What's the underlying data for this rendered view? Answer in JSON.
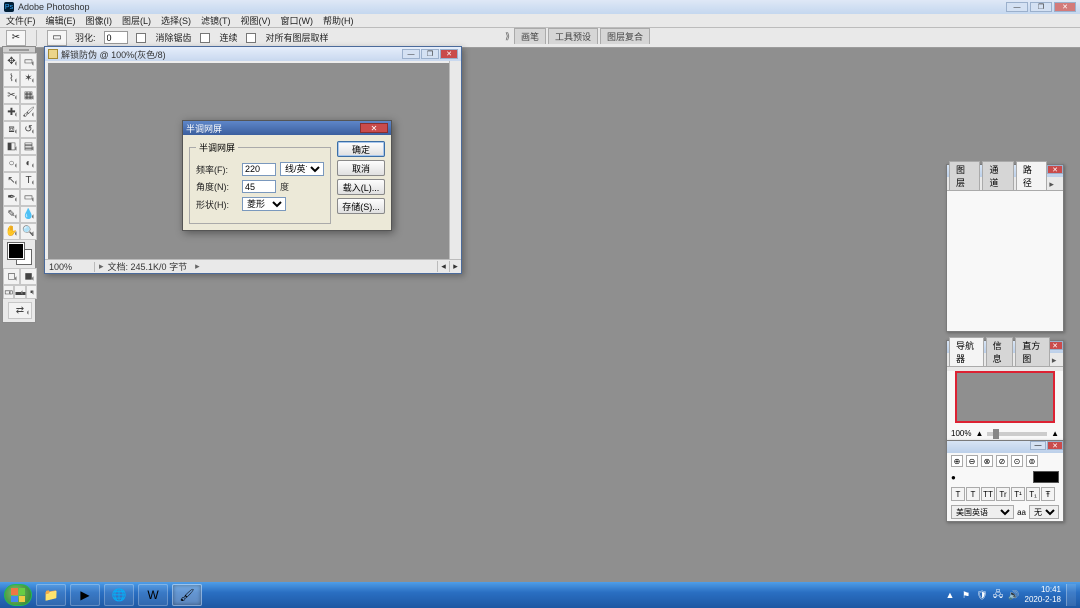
{
  "app": {
    "title": "Adobe Photoshop"
  },
  "menu": [
    "文件(F)",
    "编辑(E)",
    "图像(I)",
    "图层(L)",
    "选择(S)",
    "滤镜(T)",
    "视图(V)",
    "窗口(W)",
    "帮助(H)"
  ],
  "options": {
    "feather_label": "羽化:",
    "feather_value": "0",
    "chk1": "消除锯齿",
    "chk2": "连续",
    "chk3": "对所有图层取样"
  },
  "docks": [
    "画笔",
    "工具预设",
    "图层复合"
  ],
  "document": {
    "title": "解锁防伪 @ 100%(灰色/8)",
    "zoom": "100%",
    "status": "文档: 245.1K/0 字节"
  },
  "dialog": {
    "title": "半调网屏",
    "group": "半调网屏",
    "freq_label": "频率(F):",
    "freq_value": "220",
    "freq_unit": "线/英寸",
    "angle_label": "角度(N):",
    "angle_value": "45",
    "angle_unit": "度",
    "shape_label": "形状(H):",
    "shape_value": "菱形",
    "ok": "确定",
    "cancel": "取消",
    "load": "载入(L)...",
    "save": "存储(S)..."
  },
  "panels": {
    "layers": {
      "tabs": [
        "图层",
        "通道",
        "路径"
      ]
    },
    "nav": {
      "tabs": [
        "导航器",
        "信息",
        "直方图"
      ],
      "zoom": "100%"
    },
    "char": {
      "row1": [
        "⊕",
        "⊖",
        "⊗",
        "⊘",
        "⊙",
        "⊚"
      ],
      "font": "美国英语",
      "aa": "aa",
      "aa2": "无"
    }
  },
  "taskbar": {
    "time": "10:41",
    "date": "2020-2-18"
  }
}
